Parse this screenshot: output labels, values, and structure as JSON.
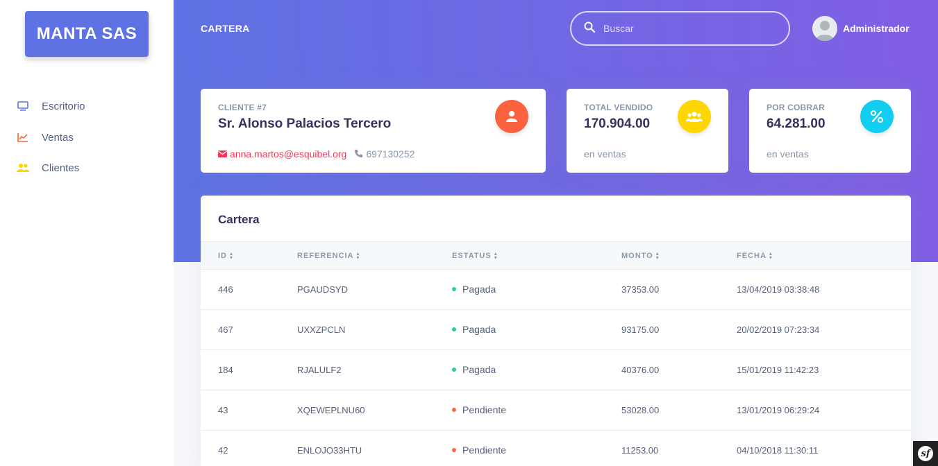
{
  "brand": {
    "name": "MANTA SAS"
  },
  "sidebar": {
    "items": [
      {
        "label": "Escritorio",
        "icon": "monitor-icon",
        "color": "#5e72e4"
      },
      {
        "label": "Ventas",
        "icon": "chart-line-icon",
        "color": "#fb6340"
      },
      {
        "label": "Clientes",
        "icon": "users-icon",
        "color": "#ffd600"
      }
    ]
  },
  "header": {
    "title": "CARTERA",
    "search_placeholder": "Buscar",
    "user_name": "Administrador"
  },
  "client_card": {
    "label": "CLIENTE #7",
    "name": "Sr. Alonso Palacios Tercero",
    "email": "anna.martos@esquibel.org",
    "phone": "697130252",
    "icon": "user-icon",
    "icon_color": "#fb6340"
  },
  "sold_card": {
    "label": "TOTAL VENDIDO",
    "value": "170.904.00",
    "sub": "en ventas",
    "icon": "users-icon",
    "icon_color": "#ffd600"
  },
  "due_card": {
    "label": "POR COBRAR",
    "value": "64.281.00",
    "sub": "en ventas",
    "icon": "percent-icon",
    "icon_color": "#11cdef"
  },
  "table": {
    "title": "Cartera",
    "columns": [
      "ID",
      "REFERENCIA",
      "ESTATUS",
      "MONTO",
      "FECHA"
    ],
    "rows": [
      {
        "id": "446",
        "ref": "PGAUDSYD",
        "status": "Pagada",
        "status_color": "#2dce89",
        "amount": "37353.00",
        "date": "13/04/2019 03:38:48"
      },
      {
        "id": "467",
        "ref": "UXXZPCLN",
        "status": "Pagada",
        "status_color": "#2dce89",
        "amount": "93175.00",
        "date": "20/02/2019 07:23:34"
      },
      {
        "id": "184",
        "ref": "RJALULF2",
        "status": "Pagada",
        "status_color": "#2dce89",
        "amount": "40376.00",
        "date": "15/01/2019 11:42:23"
      },
      {
        "id": "43",
        "ref": "XQEWEPLNU60",
        "status": "Pendiente",
        "status_color": "#fb6340",
        "amount": "53028.00",
        "date": "13/01/2019 06:29:24"
      },
      {
        "id": "42",
        "ref": "ENLOJO33HTU",
        "status": "Pendiente",
        "status_color": "#fb6340",
        "amount": "11253.00",
        "date": "04/10/2018 11:30:11"
      }
    ]
  }
}
